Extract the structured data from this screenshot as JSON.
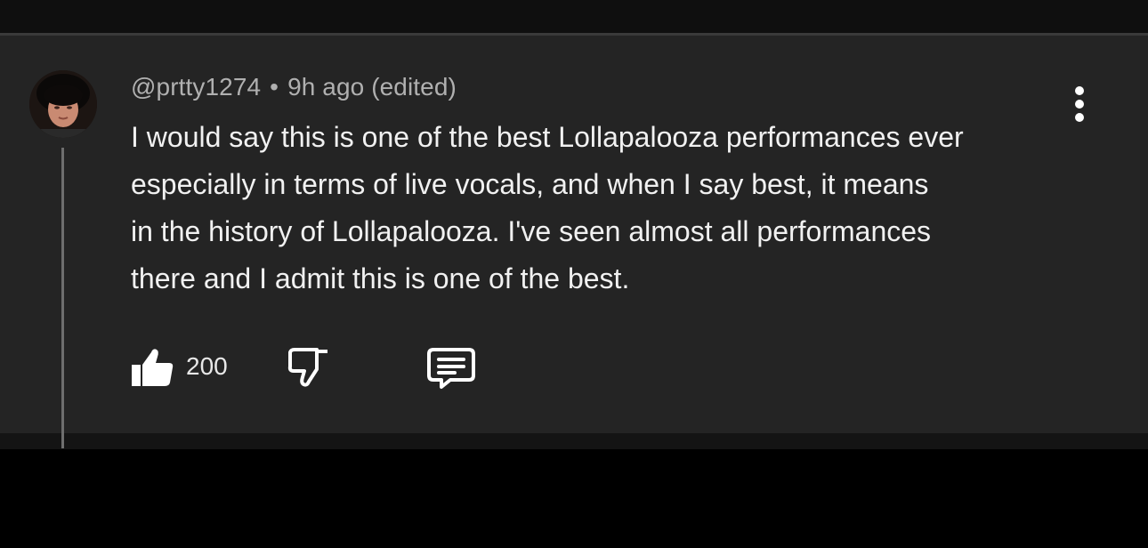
{
  "comment": {
    "author": "@prtty1274",
    "separator": "•",
    "time": "9h ago (edited)",
    "body_lines": [
      "I would say this is one of the best Lollapalooza performances ever",
      "especially in terms of live vocals, and when I say best, it means",
      "in the history of Lollapalooza. I've seen almost all performances",
      "there and I admit this is one of the best."
    ],
    "like_count": "200"
  },
  "icons": {
    "like": "thumbs-up-icon",
    "dislike": "thumbs-down-icon",
    "reply": "comment-reply-icon",
    "menu": "more-vertical-icon"
  },
  "colors": {
    "panel_background": "#242424",
    "page_background": "#000000",
    "body_text": "#f1f1f1",
    "meta_text": "#b0b0b0",
    "thread_line": "#6e6e6e"
  }
}
